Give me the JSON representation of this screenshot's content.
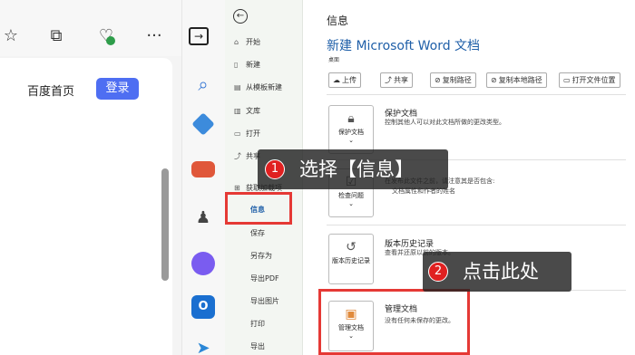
{
  "browser": {
    "baidu_home": "百度首页",
    "login": "登录",
    "accent": "#4e6ef2"
  },
  "word": {
    "nav": [
      {
        "label": "开始",
        "icon": "home-icon"
      },
      {
        "label": "新建",
        "icon": "new-doc-icon"
      },
      {
        "label": "从模板新建",
        "icon": "template-icon"
      },
      {
        "label": "文库",
        "icon": "library-icon"
      },
      {
        "label": "打开",
        "icon": "folder-icon"
      },
      {
        "label": "共享",
        "icon": "share-icon"
      },
      {
        "label": "获取加载项",
        "icon": "addins-icon"
      }
    ],
    "nav_sub": [
      "信息",
      "保存",
      "另存为",
      "导出PDF",
      "导出图片",
      "打印",
      "导出"
    ],
    "heading": "信息",
    "doc_title": "新建 Microsoft Word 文档",
    "doc_location": "桌面",
    "actions": [
      "上传",
      "共享",
      "复制路径",
      "复制本地路径",
      "打开文件位置"
    ],
    "protect": {
      "tile": "保护文档",
      "title": "保护文档",
      "desc": "控制其他人可以对此文档所做的更改类型。"
    },
    "inspect": {
      "tile": "检查问题",
      "desc1": "在发布此文件之前，请注意其是否包含:",
      "desc2": "文档属性和作者的姓名"
    },
    "history": {
      "tile": "版本历史记录",
      "title": "版本历史记录",
      "desc": "查看并还原以前的版本。"
    },
    "manage": {
      "tile": "管理文档",
      "title": "管理文档",
      "desc": "没有任何未保存的更改。"
    }
  },
  "callouts": [
    {
      "num": "1",
      "text": "选择【信息】"
    },
    {
      "num": "2",
      "text": "点击此处"
    }
  ],
  "colors": {
    "highlight": "#e53935",
    "link": "#1f5fa8"
  }
}
